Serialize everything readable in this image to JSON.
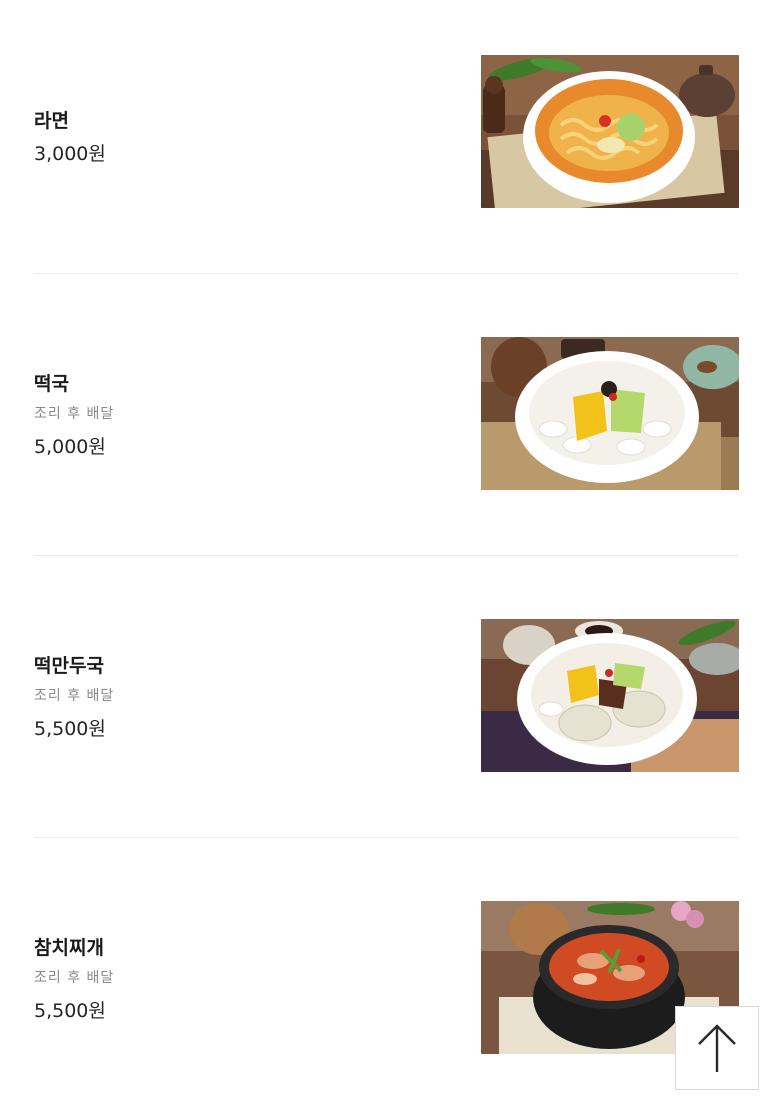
{
  "menu": {
    "items": [
      {
        "name": "라면",
        "note": "",
        "price": "3,000원",
        "image_icon": "ramen-photo"
      },
      {
        "name": "떡국",
        "note": "조리 후 배달",
        "price": "5,000원",
        "image_icon": "tteokguk-photo"
      },
      {
        "name": "떡만두국",
        "note": "조리 후 배달",
        "price": "5,500원",
        "image_icon": "tteok-mandu-guk-photo"
      },
      {
        "name": "참치찌개",
        "note": "조리 후 배달",
        "price": "5,500원",
        "image_icon": "tuna-stew-photo"
      }
    ]
  },
  "scroll_top": {
    "icon": "arrow-up-icon"
  },
  "colors": {
    "divider": "#ececec",
    "note_text": "#8a8a8a",
    "wood": "#6b4a35"
  }
}
